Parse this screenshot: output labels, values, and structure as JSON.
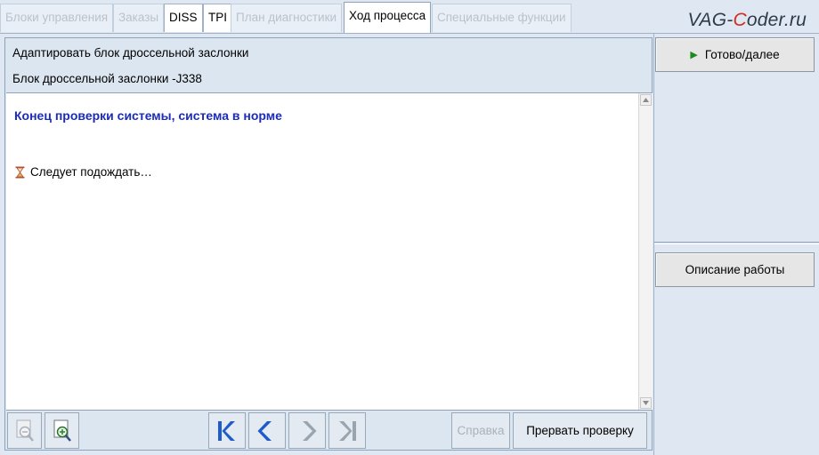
{
  "tabs": [
    {
      "label": "Блоки управления",
      "state": "disabled"
    },
    {
      "label": "Заказы",
      "state": "disabled"
    },
    {
      "label": "DISS",
      "state": "enabled"
    },
    {
      "label": "TPI",
      "state": "enabled"
    },
    {
      "label": "План диагностики",
      "state": "disabled"
    },
    {
      "label": "Ход процесса",
      "state": "selected"
    },
    {
      "label": "Специальные функции",
      "state": "disabled"
    }
  ],
  "watermark": {
    "prefix": "VAG-",
    "accent": "C",
    "suffix": "oder.ru"
  },
  "header": {
    "title": "Адаптировать блок дроссельной заслонки",
    "subtitle": "Блок дроссельной заслонки -J338"
  },
  "content": {
    "status": "Конец проверки системы, система в норме",
    "wait_text": "Следует подождать…"
  },
  "toolbar": {
    "help_label": "Справка",
    "abort_label": "Прервать проверку"
  },
  "right_panel": {
    "next_label": "Готово/далее",
    "description_label": "Описание работы"
  },
  "colors": {
    "status_text": "#1b2cb8",
    "nav_arrow_active": "#1f5bc9",
    "nav_arrow_disabled": "#9aa4ae",
    "play_icon": "#1d8a1d",
    "brand_accent": "#d32b1e"
  }
}
